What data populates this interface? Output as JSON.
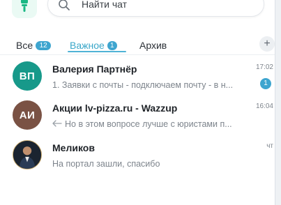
{
  "search": {
    "placeholder": "Найти чат"
  },
  "tabs": [
    {
      "label": "Все",
      "badge": "12"
    },
    {
      "label": "Важное",
      "badge": "1"
    },
    {
      "label": "Архив"
    }
  ],
  "add_label": "+",
  "chats": [
    {
      "initials": "ВП",
      "avatar_color": "#17998a",
      "name": "Валерия Партнёр",
      "time": "17:02",
      "preview": "1. Заявки с почты - подключаем почту - в н...",
      "unread": "1"
    },
    {
      "initials": "АИ",
      "avatar_color": "#7a5244",
      "name": "Акции lv-pizza.ru - Wazzup",
      "time": "16:04",
      "preview": "Но в этом вопросе лучше с юристами п..."
    },
    {
      "name": "Меликов",
      "time": "чт",
      "preview": "На портал зашли, спасибо"
    }
  ],
  "colors": {
    "accent": "#3ea5cf",
    "brand_green": "#1bb784"
  }
}
